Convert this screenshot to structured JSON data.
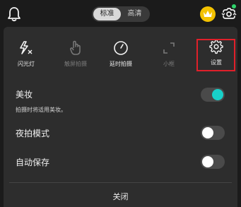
{
  "topbar": {
    "icons": {
      "notification": "bell-icon",
      "vip": "crown-icon",
      "camera_switch": "camera-flip-icon"
    },
    "quality_options": [
      "标准",
      "高清"
    ],
    "selected_quality": "标准"
  },
  "quick_options": [
    {
      "label": "闪光灯",
      "icon": "flash-auto-icon",
      "enabled": true
    },
    {
      "label": "触屏拍摄",
      "icon": "touch-icon",
      "enabled": false
    },
    {
      "label": "延时拍摄",
      "icon": "timer-icon",
      "enabled": true
    },
    {
      "label": "小框",
      "icon": "small-frame-icon",
      "enabled": false
    },
    {
      "label": "设置",
      "icon": "gear-icon",
      "enabled": true,
      "highlighted": true
    }
  ],
  "settings": {
    "beauty": {
      "label": "美妆",
      "description": "拍摄时将适用美妆。",
      "on": true
    },
    "night_mode": {
      "label": "夜拍模式",
      "on": false
    },
    "auto_save": {
      "label": "自动保存",
      "on": false
    }
  },
  "footer": {
    "close_label": "关闭"
  },
  "colors": {
    "toggle_on": "#18d1c9",
    "crown": "#f3c200",
    "highlight_box": "#e0202a",
    "status_dot": "#2fd36b"
  }
}
